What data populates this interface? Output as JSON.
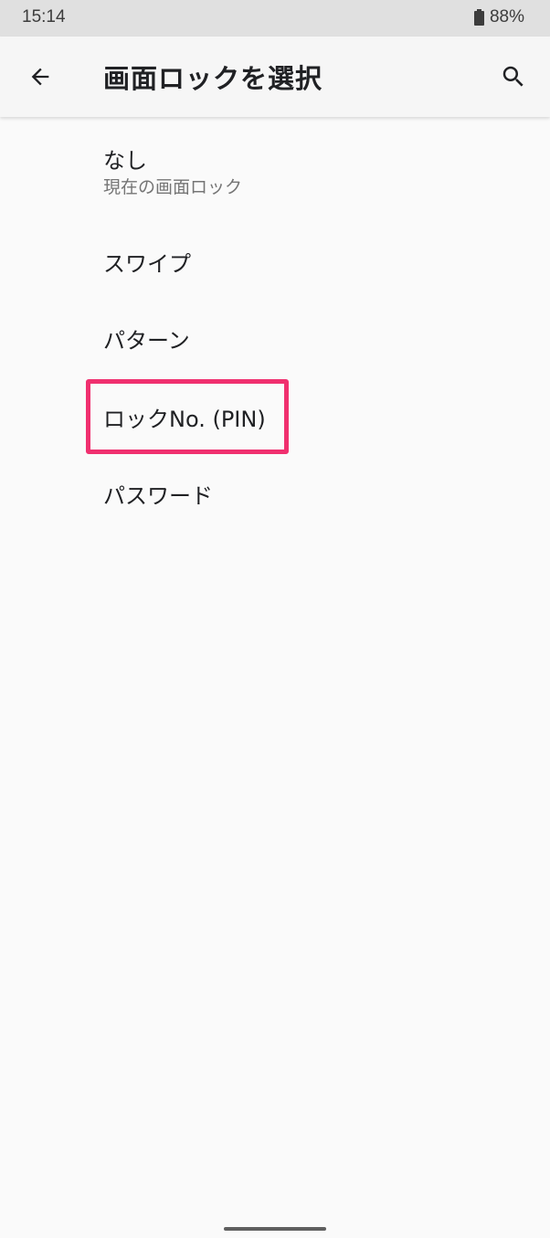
{
  "status_bar": {
    "time": "15:14",
    "battery_percent": "88%",
    "battery_icon": "battery-full-icon"
  },
  "app_bar": {
    "title": "画面ロックを選択",
    "back_icon": "arrow-back-icon",
    "search_icon": "search-icon"
  },
  "options": [
    {
      "label": "なし",
      "summary": "現在の画面ロック"
    },
    {
      "label": "スワイプ"
    },
    {
      "label": "パターン"
    },
    {
      "label": "ロックNo. (PIN)",
      "highlighted": true
    },
    {
      "label": "パスワード"
    }
  ],
  "colors": {
    "highlight": "#f0306f",
    "background": "#fafafa",
    "status_bar": "#e0e0e0"
  }
}
